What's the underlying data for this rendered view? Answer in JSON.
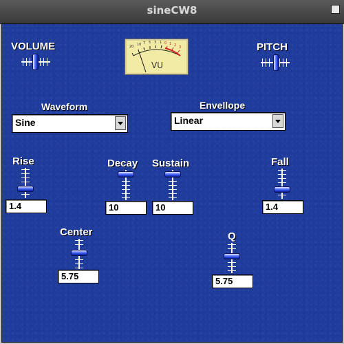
{
  "window": {
    "title": "sineCW8"
  },
  "labels": {
    "volume": "VOLUME",
    "pitch": "PITCH",
    "waveform": "Waveform",
    "envelope": "Envellope",
    "rise": "Rise",
    "decay": "Decay",
    "sustain": "Sustain",
    "fall": "Fall",
    "center": "Center",
    "q": "Q"
  },
  "selects": {
    "waveform": "Sine",
    "envelope": "Linear"
  },
  "fields": {
    "rise": "1.4",
    "decay": "10",
    "sustain": "10",
    "fall": "1.4",
    "center": "5.75",
    "q": "5.75"
  },
  "vu_meter": {
    "label": "VU",
    "scale": [
      "20",
      "10",
      "7",
      "5",
      "3",
      "1",
      "0",
      "1",
      "2",
      "3"
    ]
  },
  "colors": {
    "panel": "#1f3c9c",
    "label_text": "#ffffff",
    "meter_face": "#f2eba5",
    "meter_red": "#cc2222"
  },
  "icons": [
    "close-box-icon",
    "slider-thumb-icon"
  ]
}
